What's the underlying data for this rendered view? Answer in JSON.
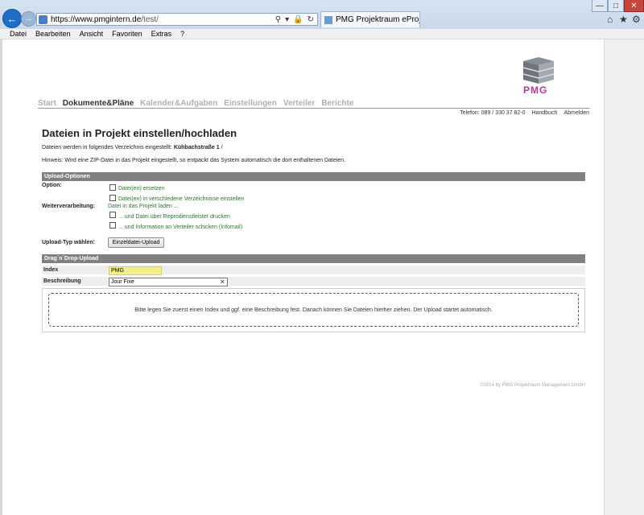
{
  "browser": {
    "url_host": "https://www.pmgintern.de",
    "url_path": "/test/",
    "tab_title": "PMG Projektraum eProject...",
    "menu": [
      "Datei",
      "Bearbeiten",
      "Ansicht",
      "Favoriten",
      "Extras",
      "?"
    ]
  },
  "logo": {
    "text": "PMG",
    "color": "#b13a9b"
  },
  "nav": {
    "items": [
      "Start",
      "Dokumente&Pläne",
      "Kalender&Aufgaben",
      "Einstellungen",
      "Verteiler",
      "Berichte"
    ],
    "active_index": 1
  },
  "topinfo": {
    "phone": "Telefon: 089 / 330 37 82-0",
    "handbook": "Handbuch",
    "logout": "Abmelden"
  },
  "page": {
    "title": "Dateien in Projekt einstellen/hochladen",
    "dir_prefix": "Dateien werden in folgendes Verzeichnis eingestellt: ",
    "dir_name": "Kühbachstraße 1",
    "dir_suffix": " /",
    "hint": "Hinweis: Wird eine ZIP-Datei in das Projekt eingestellt, so entpackt das System automatisch die dort enthaltenen Dateien."
  },
  "upload_options": {
    "header": "Upload-Optionen",
    "option_label": "Option:",
    "option_replace": "Datei(en) ersetzen",
    "option_multi_dir": "Datei(en) in verschiedene Verzeichnisse einstellen",
    "processing_label": "Weiterverarbeitung:",
    "processing_text": "Datei in das Projekt laden ...",
    "print_option": "... und Datei über Reprodienstleister drucken",
    "inform_option": "... und Information an Verteiler schicken (Infomail)",
    "upload_type_label": "Upload-Typ wählen:",
    "upload_type_button": "Einzeldatei-Upload"
  },
  "dragdrop": {
    "header": "Drag´n´Drop-Upload",
    "index_label": "Index",
    "index_value": "PMG",
    "desc_label": "Beschreibung",
    "desc_value": "Jour Fixe",
    "dropzone_text": "Bitte legen Sie zuerst einen Index und ggf. eine Beschreibung fest. Danach können Sie Dateien hierher ziehen. Der Upload startet automatisch."
  },
  "footer": "©2014 by PMG Projektraum Management GmbH"
}
